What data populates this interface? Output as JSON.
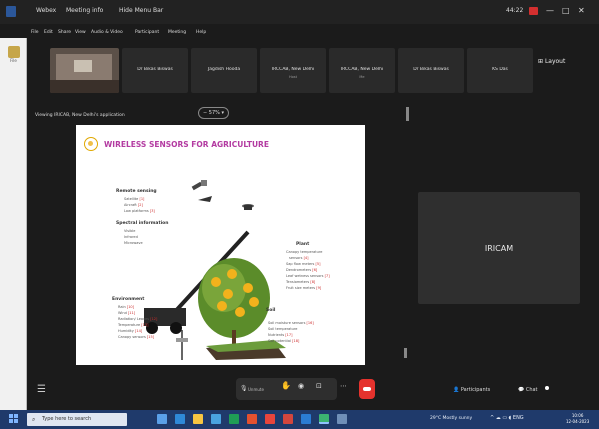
{
  "titlebar": {
    "app_name": "Webex",
    "meeting_info": "Meeting info",
    "hide_menu_bar": "Hide Menu Bar",
    "time_remaining": "44:22",
    "window_controls": [
      "—",
      "□",
      "✕"
    ]
  },
  "menubar": {
    "items": [
      "File",
      "Edit",
      "Share",
      "View",
      "Audio & Video",
      "Participant",
      "Meeting",
      "Help"
    ]
  },
  "sidebar": {
    "buttons": [
      {
        "label": "File"
      },
      {
        "label": ""
      }
    ]
  },
  "participants_strip": {
    "tiles": [
      {
        "name": "Dr Bikas Biswas",
        "sub": ""
      },
      {
        "name": "Jagdish Hooda",
        "sub": ""
      },
      {
        "name": "IRCCAB, New Delhi",
        "sub": "Host"
      },
      {
        "name": "IRCCAB, New Delhi",
        "sub": "Me"
      },
      {
        "name": "Dr Bikas Biswas",
        "sub": ""
      },
      {
        "name": "KS Das",
        "sub": ""
      }
    ],
    "layout_label": "Layout"
  },
  "share_bar": {
    "viewing_text": "Viewing IRICAB, New Delhi's application",
    "zoom_label": "57%",
    "zoom_suffix": "▾"
  },
  "slide": {
    "title": "WIRELESS SENSORS FOR AGRICULTURE",
    "sections": {
      "remote_sensing": {
        "head": "Remote sensing",
        "items": [
          {
            "text": "Satellite",
            "ref": "[1]"
          },
          {
            "text": "Aircraft",
            "ref": "[2]"
          },
          {
            "text": "Low platforms",
            "ref": "[3]"
          }
        ]
      },
      "spectral": {
        "head": "Spectral information",
        "items": [
          {
            "text": "Visible",
            "ref": ""
          },
          {
            "text": "Infrared",
            "ref": ""
          },
          {
            "text": "Microwave",
            "ref": ""
          }
        ]
      },
      "plant": {
        "head": "Plant",
        "items": [
          {
            "text": "Canopy temperature",
            "ref": ""
          },
          {
            "text": "sensors",
            "ref": "[4]"
          },
          {
            "text": "Sap flow meters",
            "ref": "[5]"
          },
          {
            "text": "Dendrometers",
            "ref": "[6]"
          },
          {
            "text": "Leaf wetness sensors",
            "ref": "[7]"
          },
          {
            "text": "Tensiometers",
            "ref": "[8]"
          },
          {
            "text": "Fruit size meters",
            "ref": "[9]"
          }
        ]
      },
      "environment": {
        "head": "Environment",
        "items": [
          {
            "text": "Rain",
            "ref": "[10]"
          },
          {
            "text": "Wind",
            "ref": "[11]"
          },
          {
            "text": "Radiation/ Leaves",
            "ref": "[12]"
          },
          {
            "text": "Temperature",
            "ref": "[13]"
          },
          {
            "text": "Humidity",
            "ref": "[14]"
          },
          {
            "text": "Canopy sensors",
            "ref": "[15]"
          }
        ]
      },
      "soil": {
        "head": "Soil",
        "items": [
          {
            "text": "Soil moisture sensors",
            "ref": "[16]"
          },
          {
            "text": "Soil temperature",
            "ref": ""
          },
          {
            "text": "Nutrients",
            "ref": "[17]"
          },
          {
            "text": "Soil potential",
            "ref": "[18]"
          }
        ]
      }
    }
  },
  "right_tile": {
    "name": "IRICAM"
  },
  "controls": {
    "unmute_label": "Unmute",
    "participants_label": "Participants",
    "chat_label": "Chat"
  },
  "taskbar": {
    "search_placeholder": "Type here to search",
    "weather": "29°C  Mostly sunny",
    "time": "10:06",
    "date": "12-04-2023",
    "lang": "ENG"
  },
  "colors": {
    "accent_magenta": "#b33aa1",
    "leave_red": "#e5322d",
    "taskbar_blue": "#1f3a6b"
  }
}
